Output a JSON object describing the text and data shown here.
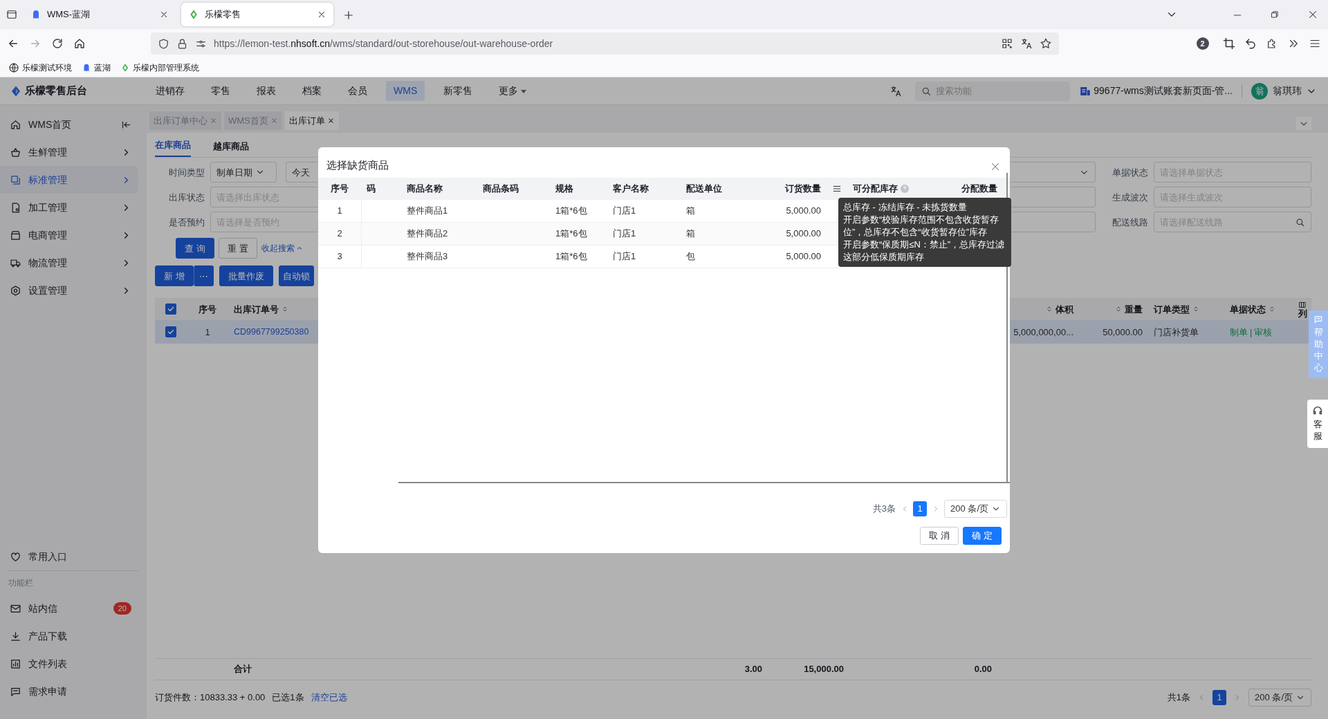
{
  "browser": {
    "tabs": [
      {
        "title": "WMS-蓝湖",
        "selected": false
      },
      {
        "title": "乐檬零售",
        "selected": true
      }
    ],
    "url": [
      "https://lemon-test.",
      "nhsoft.cn",
      "/wms/standard/out-storehouse/out-warehouse-order"
    ],
    "extension_badge": "2",
    "bookmarks": [
      "乐檬测试环境",
      "蓝湖",
      "乐檬内部管理系统"
    ]
  },
  "header": {
    "logo": "乐檬零售后台",
    "nav": [
      {
        "label": "进销存",
        "selected": false
      },
      {
        "label": "零售",
        "selected": false
      },
      {
        "label": "报表",
        "selected": false
      },
      {
        "label": "档案",
        "selected": false
      },
      {
        "label": "会员",
        "selected": false
      },
      {
        "label": "WMS",
        "selected": true
      },
      {
        "label": "新零售",
        "selected": false
      }
    ],
    "more": "更多",
    "search_placeholder": "搜索功能",
    "account": "99677-wms测试账套新页面-管...",
    "avatar": "翁",
    "user": "翁琪玮"
  },
  "sidebar": {
    "items": [
      {
        "label": "WMS首页",
        "selected": false
      },
      {
        "label": "生鲜管理",
        "selected": false
      },
      {
        "label": "标准管理",
        "selected": true
      },
      {
        "label": "加工管理",
        "selected": false
      },
      {
        "label": "电商管理",
        "selected": false
      },
      {
        "label": "物流管理",
        "selected": false
      },
      {
        "label": "设置管理",
        "selected": false
      }
    ],
    "favorites": "常用入口",
    "section": "功能栏",
    "tools": [
      {
        "label": "站内信",
        "badge": "20"
      },
      {
        "label": "产品下载"
      },
      {
        "label": "文件列表"
      },
      {
        "label": "需求申请"
      }
    ]
  },
  "page_tabs": [
    {
      "label": "出库订单中心",
      "selected": false
    },
    {
      "label": "WMS首页",
      "selected": false
    },
    {
      "label": "出库订单",
      "selected": true
    }
  ],
  "sub_tabs": [
    {
      "label": "在库商品",
      "selected": true
    },
    {
      "label": "越库商品",
      "selected": false
    }
  ],
  "filters": {
    "left": [
      {
        "label": "时间类型",
        "kind": "date",
        "value": "制单日期",
        "extra": "今天"
      },
      {
        "label": "出库状态",
        "kind": "select",
        "placeholder": "请选择出库状态"
      },
      {
        "label": "是否预约",
        "kind": "select",
        "placeholder": "请选择是否预约"
      }
    ],
    "middle": [
      {
        "kind": "select"
      },
      {
        "kind": "input"
      },
      {
        "kind": "input"
      }
    ],
    "right": [
      {
        "label": "单据状态",
        "kind": "select",
        "placeholder": "请选择单据状态"
      },
      {
        "label": "生成波次",
        "kind": "select",
        "placeholder": "请选择生成波次"
      },
      {
        "label": "配送线路",
        "kind": "search",
        "placeholder": "请选择配送线路"
      }
    ],
    "query": "查 询",
    "reset": "重 置",
    "collapse": "收起搜索"
  },
  "actions": [
    {
      "label": "新 增",
      "kind": "primary"
    },
    {
      "label": "⋯",
      "kind": "split"
    },
    {
      "label": "批量作废",
      "kind": "primary"
    },
    {
      "label": "自动锁",
      "kind": "primary"
    }
  ],
  "table": {
    "all_selected": true,
    "columns_left": [
      "序号",
      "出库订单号"
    ],
    "columns_right": [
      "体积",
      "重量",
      "订单类型",
      "单据状态"
    ],
    "settings": "列",
    "rows": [
      {
        "selected": true,
        "index": "1",
        "order_no": "CD9967799250380",
        "volume": "5,000,000,00...",
        "weight": "50,000.00",
        "type": "门店补货单",
        "actions": [
          "制单",
          "审核"
        ],
        "separator": "|"
      }
    ],
    "totals": {
      "label": "合计",
      "values": [
        "3.00",
        "15,000.00",
        "0.00"
      ]
    }
  },
  "footer": {
    "summary": "订货件数：10833.33 + 0.00",
    "selected_count": "已选1条",
    "clear": "清空已选",
    "total": "共1条",
    "page": "1",
    "page_size": "200 条/页"
  },
  "help": {
    "help_center": "帮助中心",
    "service": "客服"
  },
  "modal": {
    "title": "选择缺货商品",
    "columns": [
      "序号",
      "码",
      "商品名称",
      "商品条码",
      "规格",
      "客户名称",
      "配送单位",
      "订货数量",
      "可分配库存",
      "分配数量"
    ],
    "rows": [
      {
        "index": "1",
        "name": "整件商品1",
        "spec": "1箱*6包",
        "customer": "门店1",
        "unit": "箱",
        "qty": "5,000.00"
      },
      {
        "index": "2",
        "name": "整件商品2",
        "spec": "1箱*6包",
        "customer": "门店1",
        "unit": "箱",
        "qty": "5,000.00"
      },
      {
        "index": "3",
        "name": "整件商品3",
        "spec": "1箱*6包",
        "customer": "门店1",
        "unit": "包",
        "qty": "5,000.00"
      }
    ],
    "tooltip": [
      "总库存 - 冻结库存 - 未拣货数量",
      "开启参数“校验库存范围不包含收货暂存位”，总库存不包含“收货暂存位”库存",
      "开启参数“保质期≤N：禁止”，总库存过滤这部分低保质期库存"
    ],
    "total": "共3条",
    "page": "1",
    "page_size": "200 条/页",
    "cancel": "取 消",
    "ok": "确 定"
  }
}
